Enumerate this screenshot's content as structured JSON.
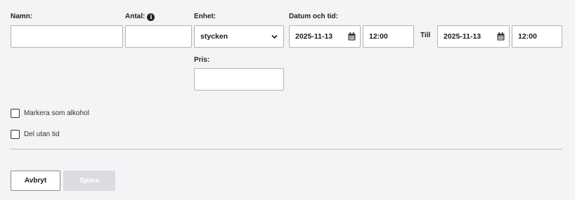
{
  "form": {
    "name": {
      "label": "Namn:",
      "value": ""
    },
    "quantity": {
      "label": "Antal:",
      "value": "",
      "info_icon": "info-icon"
    },
    "unit": {
      "label": "Enhet:",
      "selected": "stycken",
      "icon": "chevron-down-icon"
    },
    "datetime": {
      "label": "Datum och tid:",
      "from_date": "2025-11-13",
      "from_time": "12:00",
      "to_label": "Till",
      "to_date": "2025-11-13",
      "to_time": "12:00",
      "date_icon": "calendar-icon"
    },
    "price": {
      "label": "Pris:",
      "value": ""
    },
    "checkboxes": [
      {
        "label": "Markera som alkohol",
        "checked": false
      },
      {
        "label": "Del utan tid",
        "checked": false
      }
    ]
  },
  "actions": {
    "cancel_label": "Avbryt",
    "save_label": "Spara"
  },
  "colors": {
    "background": "#f4f4f6",
    "save_disabled": "#dcdce0",
    "border": "#b3b3b8"
  }
}
